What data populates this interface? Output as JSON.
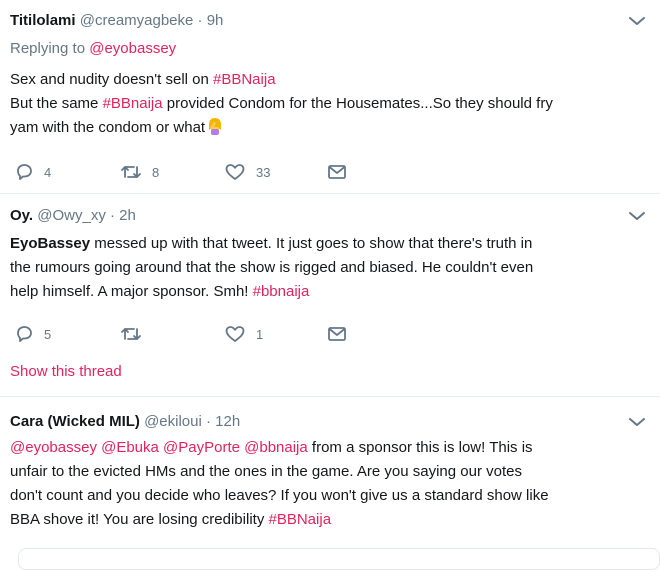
{
  "tweets": [
    {
      "name": "Titilolami",
      "handle": "@creamyagbeke",
      "dot": "·",
      "time": "9h",
      "replying_prefix": "Replying to",
      "replying_to": "@eyobassey",
      "line1_text": "Sex and nudity doesn't sell on ",
      "line1_tag": "#BBNaija",
      "line2_text_a": "But the same ",
      "line2_tag": "#BBnaija",
      "line2_text_b": " provided Condom for the Housemates...So they should fry",
      "line3_text": "yam with the condom or what",
      "emoji": "woman-facepalming",
      "reply_count": "4",
      "retweet_count": "8",
      "like_count": "33"
    },
    {
      "name": "Oy.",
      "handle": "@Owy_xy",
      "dot": "·",
      "time": "2h",
      "mention": "EyoBassey",
      "line1_text": " messed up with that tweet. It just goes to show that there's truth in",
      "line2_text": "the rumours going around that the show is rigged and biased. He couldn't even",
      "line3_text": "help himself. A major sponsor. Smh! ",
      "line3_tag": "#bbnaija",
      "reply_count": "5",
      "retweet_count": "",
      "like_count": "1",
      "show_thread": "Show this thread"
    },
    {
      "name": "Cara (Wicked MIL)",
      "handle": "@ekiloui",
      "dot": "·",
      "time": "12h",
      "mentions": "@eyobassey @Ebuka @PayPorte @bbnaija",
      "line1_text": " from a sponsor this is low! This is",
      "line2_text": "unfair to the evicted HMs and the ones in the game. Are you saying our votes",
      "line3_text": "don't count and you decide who leaves? If you won't give us a standard show like",
      "line4_text": "BBA shove it! You are losing credibility ",
      "line4_tag": "#BBNaija"
    }
  ],
  "icons": {
    "chevron": "chevron-down-icon",
    "reply": "reply-icon",
    "retweet": "retweet-icon",
    "like": "heart-icon",
    "dm": "envelope-icon"
  },
  "colors": {
    "accent": "#e0245e",
    "muted": "#657786",
    "divider": "#e6ecf0"
  }
}
